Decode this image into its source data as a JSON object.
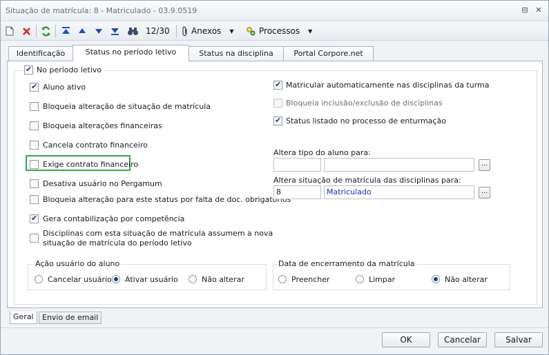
{
  "window": {
    "title": "Situação de matrícula: 8 - Matriculado - 03.9.0519",
    "restore_glyph": "⊟",
    "close_glyph": "✕"
  },
  "toolbar": {
    "record_counter": "12/30",
    "anexos_label": "Anexos",
    "processos_label": "Processos",
    "dropdown_glyph": "▼"
  },
  "tabs": [
    {
      "label": "Identificação",
      "active": false
    },
    {
      "label": "Status no período letivo",
      "active": true
    },
    {
      "label": "Status na disciplina",
      "active": false
    },
    {
      "label": "Portal Corpore.net",
      "active": false
    }
  ],
  "periodo": {
    "group_label": "No período letivo",
    "group_checked": true,
    "left_checkboxes": [
      {
        "label": "Aluno ativo",
        "checked": true
      },
      {
        "label": "Bloqueia alteração de situação de matrícula",
        "checked": false
      },
      {
        "label": "Bloqueia alterações financeiras",
        "checked": false
      },
      {
        "label": "Cancela contrato financeiro",
        "checked": false
      },
      {
        "label": "Exige contrato financeiro",
        "checked": false,
        "highlighted": true
      },
      {
        "label": "Desativa usuário no Pergamum",
        "checked": false
      },
      {
        "label": "Bloqueia alteração para este status por falta de doc. obrigatórios",
        "checked": false
      },
      {
        "label": "Gera contabilização por competência",
        "checked": true
      },
      {
        "label": "Disciplinas com esta situação de matrícula assumem a nova",
        "label2": "situação de matrícula do período letivo",
        "checked": false
      }
    ],
    "right_checkboxes": [
      {
        "label": "Matricular automaticamente nas disciplinas da turma",
        "checked": true
      },
      {
        "label": "Bloqueia inclusão/exclusão de disciplinas",
        "checked": false,
        "disabled": true
      },
      {
        "label": "Status listado no processo de enturmação",
        "checked": true
      }
    ],
    "tipo_aluno": {
      "label": "Altera tipo do aluno para:",
      "code": "",
      "description": ""
    },
    "situacao_disciplinas": {
      "label": "Altera situação de matrícula das disciplinas para:",
      "code": "8",
      "description": "Matriculado"
    },
    "ellipsis_label": "...",
    "acao_usuario": {
      "legend": "Ação usuário do aluno",
      "options": [
        {
          "label": "Cancelar usuário",
          "selected": false
        },
        {
          "label": "Ativar usuário",
          "selected": true
        },
        {
          "label": "Não alterar",
          "selected": false
        }
      ]
    },
    "data_encerramento": {
      "legend": "Data de encerramento da matrícula",
      "options": [
        {
          "label": "Preencher",
          "selected": false
        },
        {
          "label": "Limpar",
          "selected": false
        },
        {
          "label": "Não alterar",
          "selected": true
        }
      ]
    }
  },
  "bottom_tabs": [
    {
      "label": "Geral",
      "active": true
    },
    {
      "label": "Envio de email",
      "active": false
    }
  ],
  "buttons": {
    "ok": "OK",
    "cancel": "Cancelar",
    "save": "Salvar"
  },
  "colors": {
    "highlight_border": "#2fa84f",
    "link_value": "#1b2fa8",
    "accent": "#1f3c78"
  }
}
